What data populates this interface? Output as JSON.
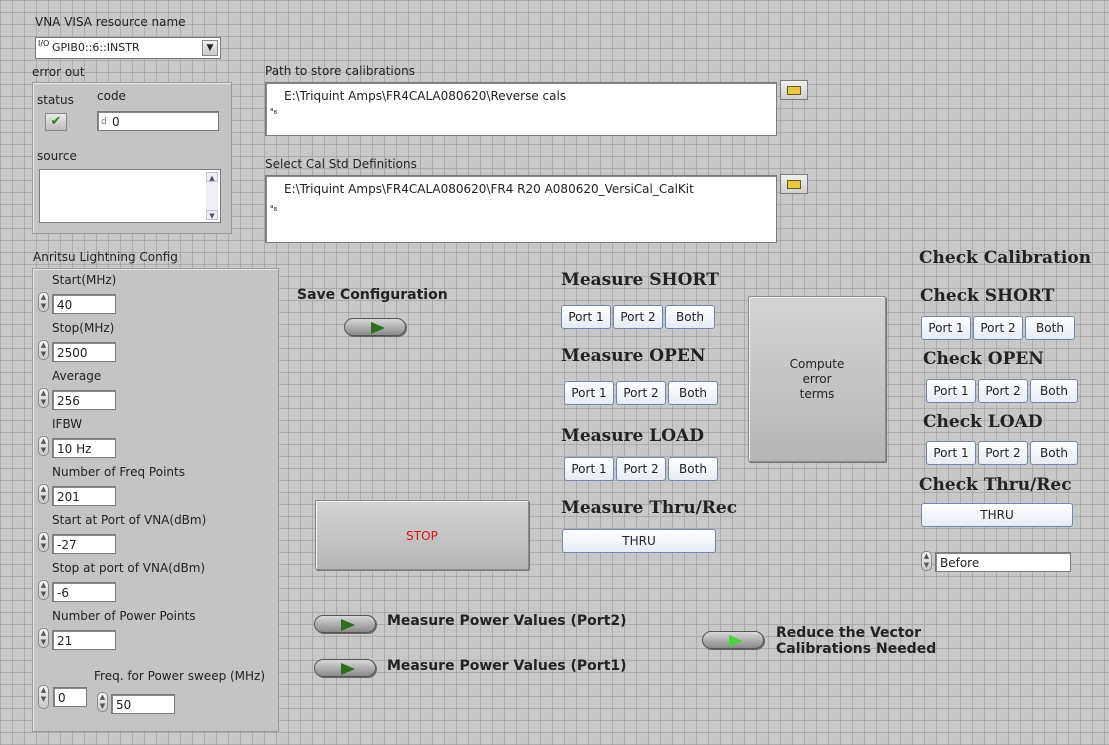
{
  "visa": {
    "label": "VNA VISA resource name",
    "value": "GPIB0::6::INSTR",
    "io_icon": "I/O"
  },
  "error_out": {
    "label": "error out",
    "status_label": "status",
    "code_label": "code",
    "code_value": "0",
    "code_prefix": "d",
    "source_label": "source",
    "status_icon": "checkmark-icon"
  },
  "paths": {
    "cal_label": "Path to store calibrations",
    "cal_value": "E:\\Triquint Amps\\FR4CALA080620\\Reverse cals",
    "std_label": "Select Cal Std Definitions",
    "std_value": "E:\\Triquint Amps\\FR4CALA080620\\FR4 R20 A080620_VersiCal_CalKit"
  },
  "config": {
    "title": "Anritsu Lightning Config",
    "fields": [
      {
        "label": "Start(MHz)",
        "value": "40"
      },
      {
        "label": "Stop(MHz)",
        "value": "2500"
      },
      {
        "label": "Average",
        "value": "256"
      },
      {
        "label": "IFBW",
        "value": "10 Hz"
      },
      {
        "label": "Number of Freq Points",
        "value": "201"
      },
      {
        "label": "Start at Port of VNA(dBm)",
        "value": "-27"
      },
      {
        "label": "Stop at port of VNA(dBm)",
        "value": "-6"
      },
      {
        "label": "Number of Power Points",
        "value": "21"
      }
    ],
    "freq_power_label": "Freq. for Power sweep (MHz)",
    "idx_value": "0",
    "freq_power_value": "50"
  },
  "save_config": {
    "label": "Save Configuration"
  },
  "measure": {
    "short": "Measure SHORT",
    "open": "Measure OPEN",
    "load": "Measure LOAD",
    "thru": "Measure Thru/Rec",
    "port1": "Port 1",
    "port2": "Port 2",
    "both": "Both",
    "thru_btn": "THRU"
  },
  "compute": {
    "label": "Compute\nerror\nterms"
  },
  "stop": {
    "label": "STOP",
    "color": "#e01010"
  },
  "check": {
    "title": "Check Calibration",
    "short": "Check SHORT",
    "open": "Check OPEN",
    "load": "Check LOAD",
    "thru": "Check Thru/Rec",
    "thru_btn": "THRU",
    "ring_value": "Before"
  },
  "power": {
    "port2_label": "Measure Power Values (Port2)",
    "port1_label": "Measure Power Values (Port1)",
    "reduce_label_1": "Reduce the Vector",
    "reduce_label_2": "Calibrations Needed"
  }
}
